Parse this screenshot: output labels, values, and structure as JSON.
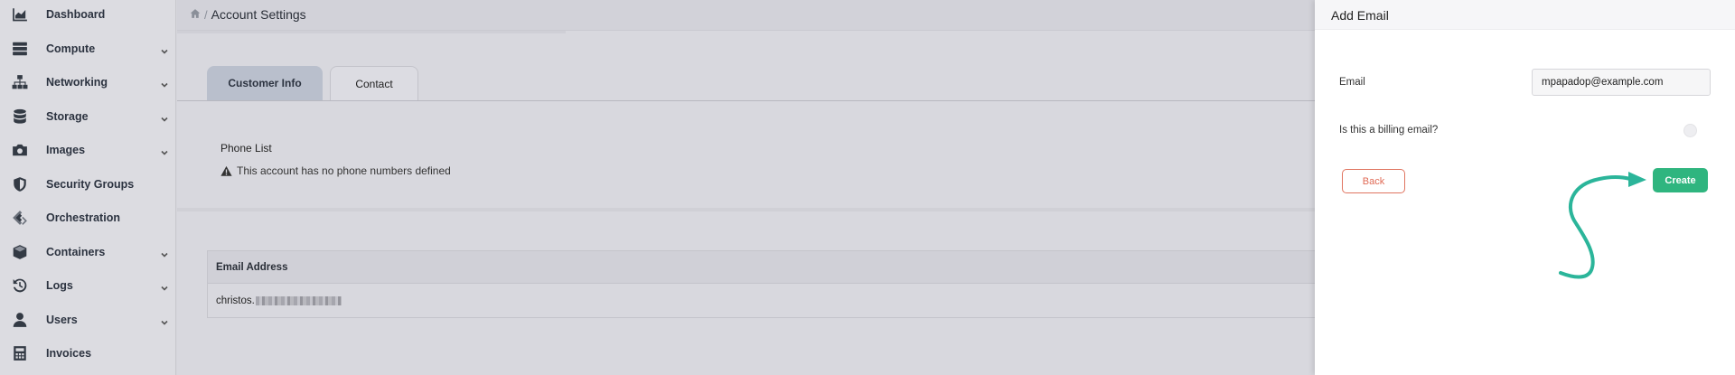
{
  "sidebar": {
    "items": [
      {
        "label": "Dashboard",
        "icon": "chart-area-icon",
        "has_chevron": false
      },
      {
        "label": "Compute",
        "icon": "server-icon",
        "has_chevron": true
      },
      {
        "label": "Networking",
        "icon": "network-icon",
        "has_chevron": true
      },
      {
        "label": "Storage",
        "icon": "database-icon",
        "has_chevron": true
      },
      {
        "label": "Images",
        "icon": "camera-icon",
        "has_chevron": true
      },
      {
        "label": "Security Groups",
        "icon": "shield-icon",
        "has_chevron": false
      },
      {
        "label": "Orchestration",
        "icon": "orchestration-icon",
        "has_chevron": false
      },
      {
        "label": "Containers",
        "icon": "cube-icon",
        "has_chevron": true
      },
      {
        "label": "Logs",
        "icon": "history-icon",
        "has_chevron": true
      },
      {
        "label": "Users",
        "icon": "user-icon",
        "has_chevron": true
      },
      {
        "label": "Invoices",
        "icon": "calculator-icon",
        "has_chevron": false
      }
    ]
  },
  "breadcrumb": {
    "separator": "/",
    "title": "Account Settings"
  },
  "tabs": {
    "customer_info": "Customer Info",
    "contact": "Contact"
  },
  "phone": {
    "title": "Phone List",
    "empty_message": "This account has no phone numbers defined"
  },
  "email_table": {
    "header": "Email Address",
    "rows": [
      {
        "email_visible_prefix": "christos."
      }
    ]
  },
  "panel": {
    "title": "Add Email",
    "email_label": "Email",
    "email_value": "mpapadop@example.com",
    "billing_label": "Is this a billing email?",
    "back_label": "Back",
    "create_label": "Create"
  },
  "colors": {
    "accent": "#2fb57f",
    "back": "#e06a55",
    "tab_active": "#b9bfcc"
  }
}
